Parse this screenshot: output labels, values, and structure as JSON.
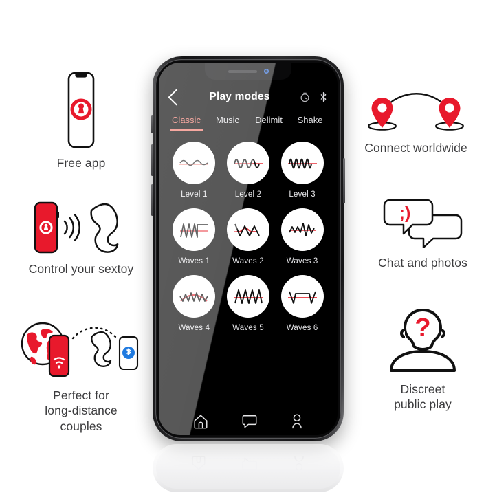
{
  "brand": {
    "red": "#e8192c",
    "accent_salmon": "#f2786c",
    "text_gray": "#3b3b3d"
  },
  "phone": {
    "status": {
      "camera_icon": "front-camera-dot",
      "speaker_icon": "earpiece-speaker"
    },
    "app": {
      "header": {
        "back_icon": "back-chevron-icon",
        "title": "Play modes",
        "actions": [
          {
            "icon": "timer-icon",
            "name": "timer"
          },
          {
            "icon": "bluetooth-icon",
            "name": "bluetooth"
          }
        ]
      },
      "tabs": [
        {
          "label": "Classic",
          "active": true
        },
        {
          "label": "Music",
          "active": false
        },
        {
          "label": "Delimit",
          "active": false
        },
        {
          "label": "Shake",
          "active": false
        }
      ],
      "modes": [
        {
          "label": "Level 1",
          "icon": "waveform-level-1"
        },
        {
          "label": "Level 2",
          "icon": "waveform-level-2"
        },
        {
          "label": "Level 3",
          "icon": "waveform-level-3"
        },
        {
          "label": "Waves 1",
          "icon": "waveform-waves-1"
        },
        {
          "label": "Waves 2",
          "icon": "waveform-waves-2"
        },
        {
          "label": "Waves 3",
          "icon": "waveform-waves-3"
        },
        {
          "label": "Waves 4",
          "icon": "waveform-waves-4"
        },
        {
          "label": "Waves 5",
          "icon": "waveform-waves-5"
        },
        {
          "label": "Waves 6",
          "icon": "waveform-waves-6"
        }
      ],
      "navbar": [
        {
          "icon": "home-icon",
          "name": "home"
        },
        {
          "icon": "chat-bubble-icon",
          "name": "messages"
        },
        {
          "icon": "person-icon",
          "name": "profile"
        }
      ]
    }
  },
  "features": {
    "free_app": {
      "caption": "Free app",
      "icon": "phone-with-lock-icon"
    },
    "control": {
      "caption": "Control your sextoy",
      "icon": "phone-signal-toy-icon"
    },
    "distance": {
      "caption": "Perfect for\nlong-distance\ncouples",
      "icon": "globe-phone-toy-bluetooth-icon"
    },
    "connect": {
      "caption": "Connect worldwide",
      "icon": "two-map-pins-arc-icon"
    },
    "chat": {
      "caption": "Chat and photos",
      "icon": "speech-bubbles-wink-icon",
      "emoticon": ";)"
    },
    "discreet": {
      "caption": "Discreet\npublic play",
      "icon": "anonymous-person-question-icon",
      "glyph": "?"
    }
  }
}
